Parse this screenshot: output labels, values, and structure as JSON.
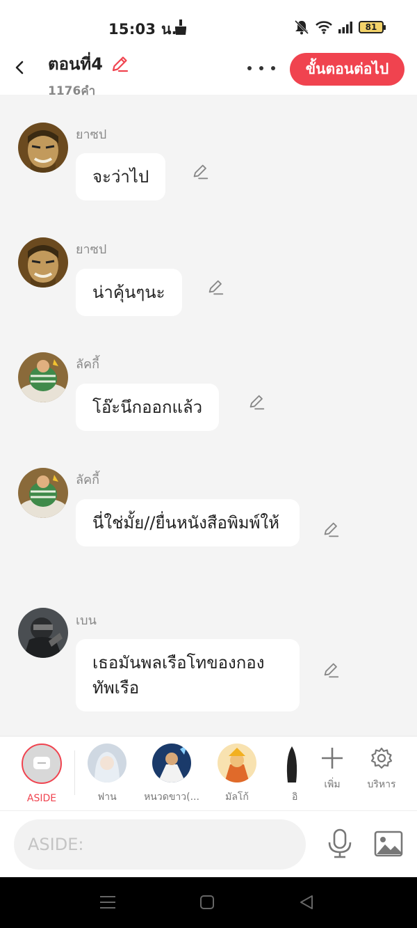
{
  "status": {
    "time": "15:03 น.",
    "battery": "81"
  },
  "header": {
    "title": "ตอนที่4",
    "word_count": "1176คำ",
    "next_label": "ขั้นตอนต่อไป"
  },
  "messages": [
    {
      "name": "ยาซป",
      "text": "จะว่าไป"
    },
    {
      "name": "ยาซป",
      "text": "น่าคุ้นๆนะ"
    },
    {
      "name": "ลัคกี้",
      "text": "โอ๊ะนึกออกแล้ว"
    },
    {
      "name": "ลัคกี้",
      "text": "นี่ใช่มั้ย//ยื่นหนังสือพิมพ์ให้"
    },
    {
      "name": "เบน",
      "text": "เธอมันพลเรือโทของกองทัพเรือ"
    }
  ],
  "characters": [
    {
      "label": "ASIDE"
    },
    {
      "label": "ฟาน"
    },
    {
      "label": "หนวดขาว(..."
    },
    {
      "label": "มัลโก้"
    },
    {
      "label": "อิ"
    }
  ],
  "tools": {
    "add_label": "เพิ่ม",
    "manage_label": "บริหาร"
  },
  "input": {
    "placeholder": "ASIDE:"
  },
  "colors": {
    "accent": "#f0434f",
    "background": "#f4f4f4"
  }
}
